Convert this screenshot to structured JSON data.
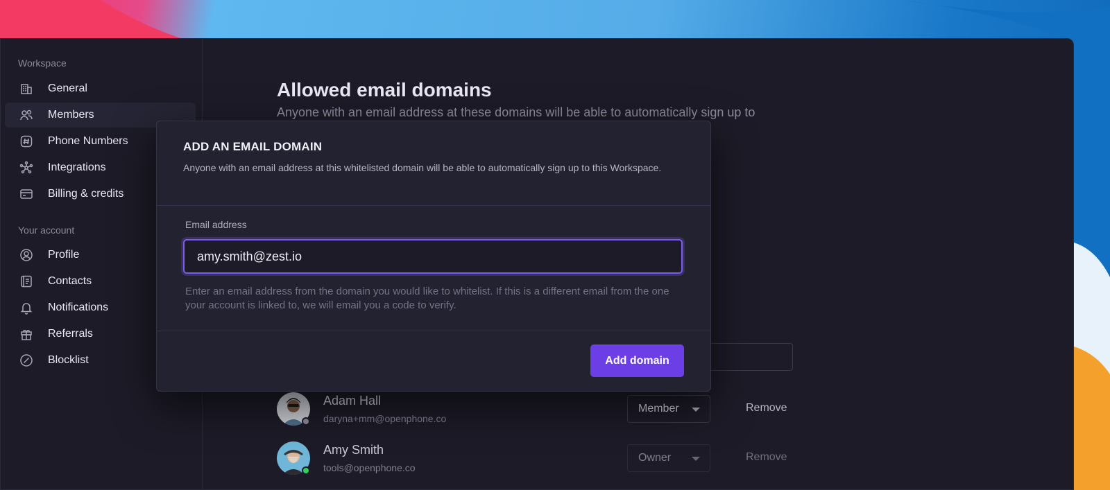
{
  "sidebar": {
    "workspace_heading": "Workspace",
    "workspace_items": [
      {
        "label": "General",
        "icon": "building-icon"
      },
      {
        "label": "Members",
        "icon": "users-icon",
        "active": true
      },
      {
        "label": "Phone Numbers",
        "icon": "hash-icon"
      },
      {
        "label": "Integrations",
        "icon": "integrations-icon"
      },
      {
        "label": "Billing & credits",
        "icon": "credit-card-icon"
      }
    ],
    "account_heading": "Your account",
    "account_items": [
      {
        "label": "Profile",
        "icon": "profile-icon"
      },
      {
        "label": "Contacts",
        "icon": "contacts-icon"
      },
      {
        "label": "Notifications",
        "icon": "bell-icon"
      },
      {
        "label": "Referrals",
        "icon": "gift-icon"
      },
      {
        "label": "Blocklist",
        "icon": "block-icon"
      }
    ]
  },
  "main": {
    "title": "Allowed email domains",
    "subtitle": "Anyone with an email address at these domains will be able to automatically sign up to"
  },
  "members": [
    {
      "name": "Adam Hall",
      "email": "daryna+mm@openphone.co",
      "role": "Member",
      "remove_label": "Remove",
      "status_color": "#8c8b9a"
    },
    {
      "name": "Amy Smith",
      "email": "tools@openphone.co",
      "role": "Owner",
      "remove_label": "Remove",
      "status_color": "#2fd15b"
    }
  ],
  "modal": {
    "title": "ADD AN EMAIL DOMAIN",
    "description": "Anyone with an email address at this whitelisted domain will be able to automatically sign up to this Workspace.",
    "field_label": "Email address",
    "email_value": "amy.smith@zest.io",
    "hint": "Enter an email address from the domain you would like to whitelist. If this is a different email from the one your account is linked to, we will email you a code to verify.",
    "submit_label": "Add domain"
  },
  "colors": {
    "accent": "#6c3fe6",
    "online": "#2fd15b",
    "window_bg": "#1c1b27"
  }
}
